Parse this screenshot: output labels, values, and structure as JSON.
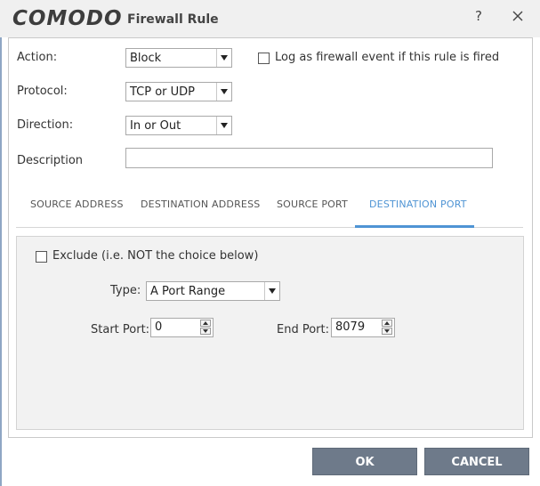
{
  "window": {
    "logo": "COMODO",
    "title": "Firewall Rule",
    "help": "?"
  },
  "form": {
    "action_label": "Action:",
    "action_value": "Block",
    "log_label": "Log as firewall event if this rule is fired",
    "log_checked": false,
    "protocol_label": "Protocol:",
    "protocol_value": "TCP or UDP",
    "direction_label": "Direction:",
    "direction_value": "In or Out",
    "description_label": "Description",
    "description_value": ""
  },
  "tabs": [
    {
      "label": "SOURCE ADDRESS",
      "active": false
    },
    {
      "label": "DESTINATION ADDRESS",
      "active": false
    },
    {
      "label": "SOURCE PORT",
      "active": false
    },
    {
      "label": "DESTINATION PORT",
      "active": true
    }
  ],
  "destination_port": {
    "exclude_label": "Exclude (i.e. NOT the choice below)",
    "exclude_checked": false,
    "type_label": "Type:",
    "type_value": "A Port Range",
    "start_label": "Start Port:",
    "start_value": "0",
    "end_label": "End Port:",
    "end_value": "8079"
  },
  "footer": {
    "ok_label": "OK",
    "cancel_label": "CANCEL"
  },
  "colors": {
    "accent": "#4f94d4",
    "button": "#6e7a8a"
  }
}
